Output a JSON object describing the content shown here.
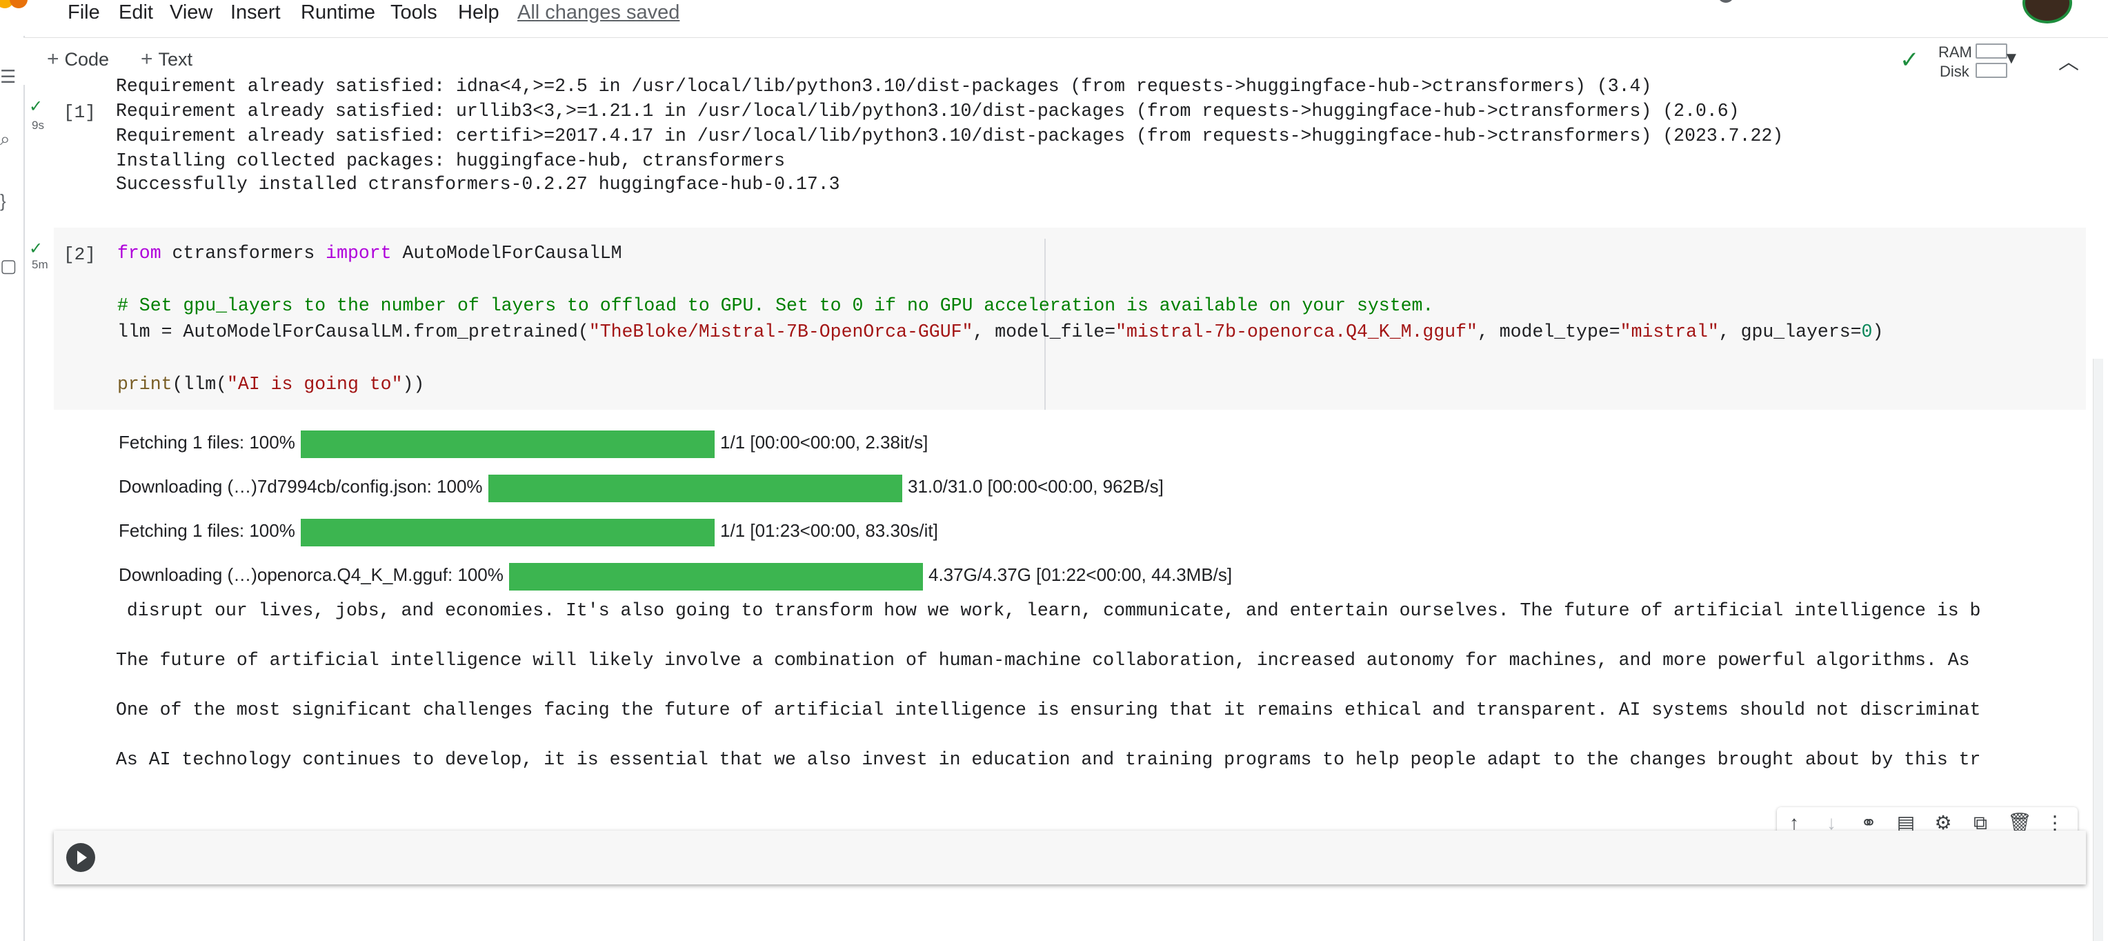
{
  "menubar": {
    "items": [
      "File",
      "Edit",
      "View",
      "Insert",
      "Runtime",
      "Tools",
      "Help"
    ],
    "saved_status": "All changes saved"
  },
  "toolbar": {
    "add_code_label": "Code",
    "add_text_label": "Text",
    "ram_label": "RAM",
    "disk_label": "Disk"
  },
  "cells": [
    {
      "number": "[1]",
      "time": "9s",
      "output": [
        "Requirement already satisfied: idna<4,>=2.5 in /usr/local/lib/python3.10/dist-packages (from requests->huggingface-hub->ctransformers) (3.4)",
        "Requirement already satisfied: urllib3<3,>=1.21.1 in /usr/local/lib/python3.10/dist-packages (from requests->huggingface-hub->ctransformers) (2.0.6)",
        "Requirement already satisfied: certifi>=2017.4.17 in /usr/local/lib/python3.10/dist-packages (from requests->huggingface-hub->ctransformers) (2023.7.22)",
        "Installing collected packages: huggingface-hub, ctransformers",
        "Successfully installed ctransformers-0.2.27 huggingface-hub-0.17.3"
      ]
    },
    {
      "number": "[2]",
      "time": "5m",
      "code": {
        "line1": {
          "kw1": "from",
          "mod": " ctransformers ",
          "kw2": "import",
          "name": " AutoModelForCausalLM"
        },
        "comment": "# Set gpu_layers to the number of layers to offload to GPU. Set to 0 if no GPU acceleration is available on your system.",
        "line3": {
          "pre": "llm = AutoModelForCausalLM.from_pretrained(",
          "s1": "\"TheBloke/Mistral-7B-OpenOrca-GGUF\"",
          "p1": ", model_file=",
          "s2": "\"mistral-7b-openorca.Q4_K_M.gguf\"",
          "p2": ", model_type=",
          "s3": "\"mistral\"",
          "p3": ", gpu_layers=",
          "n": "0",
          "close": ")"
        },
        "line4": {
          "fn": "print",
          "open": "(llm(",
          "s": "\"AI is going to\"",
          "close": "))"
        }
      },
      "progress": [
        {
          "label": "Fetching 1 files: 100%",
          "value": 1.0,
          "stats": "1/1 [00:00<00:00, 2.38it/s]"
        },
        {
          "label": "Downloading (…)7d7994cb/config.json: 100%",
          "value": 1.0,
          "stats": "31.0/31.0 [00:00<00:00, 962B/s]"
        },
        {
          "label": "Fetching 1 files: 100%",
          "value": 1.0,
          "stats": "1/1 [01:23<00:00, 83.30s/it]"
        },
        {
          "label": "Downloading (…)openorca.Q4_K_M.gguf: 100%",
          "value": 1.0,
          "stats": "4.37G/4.37G [01:22<00:00, 44.3MB/s]"
        }
      ],
      "text_output": [
        " disrupt our lives, jobs, and economies. It's also going to transform how we work, learn, communicate, and entertain ourselves. The future of artificial intelligence is b",
        "The future of artificial intelligence will likely involve a combination of human-machine collaboration, increased autonomy for machines, and more powerful algorithms. As",
        "One of the most significant challenges facing the future of artificial intelligence is ensuring that it remains ethical and transparent. AI systems should not discriminat",
        "As AI technology continues to develop, it is essential that we also invest in education and training programs to help people adapt to the changes brought about by this tr"
      ]
    }
  ],
  "colors": {
    "progress_fill": "#3cb550",
    "keyword": "#af00db",
    "string": "#a31515",
    "comment": "#008000",
    "check": "#1e8e3e"
  },
  "icons": [
    "check-icon",
    "play-icon",
    "arrow-up-icon",
    "arrow-down-icon",
    "link-icon",
    "comment-icon",
    "gear-icon",
    "mirror-cell-icon",
    "trash-icon",
    "more-vert-icon",
    "chevron-down-icon",
    "chevron-up-icon",
    "menu-icon",
    "search-icon",
    "braces-icon",
    "folder-icon"
  ]
}
